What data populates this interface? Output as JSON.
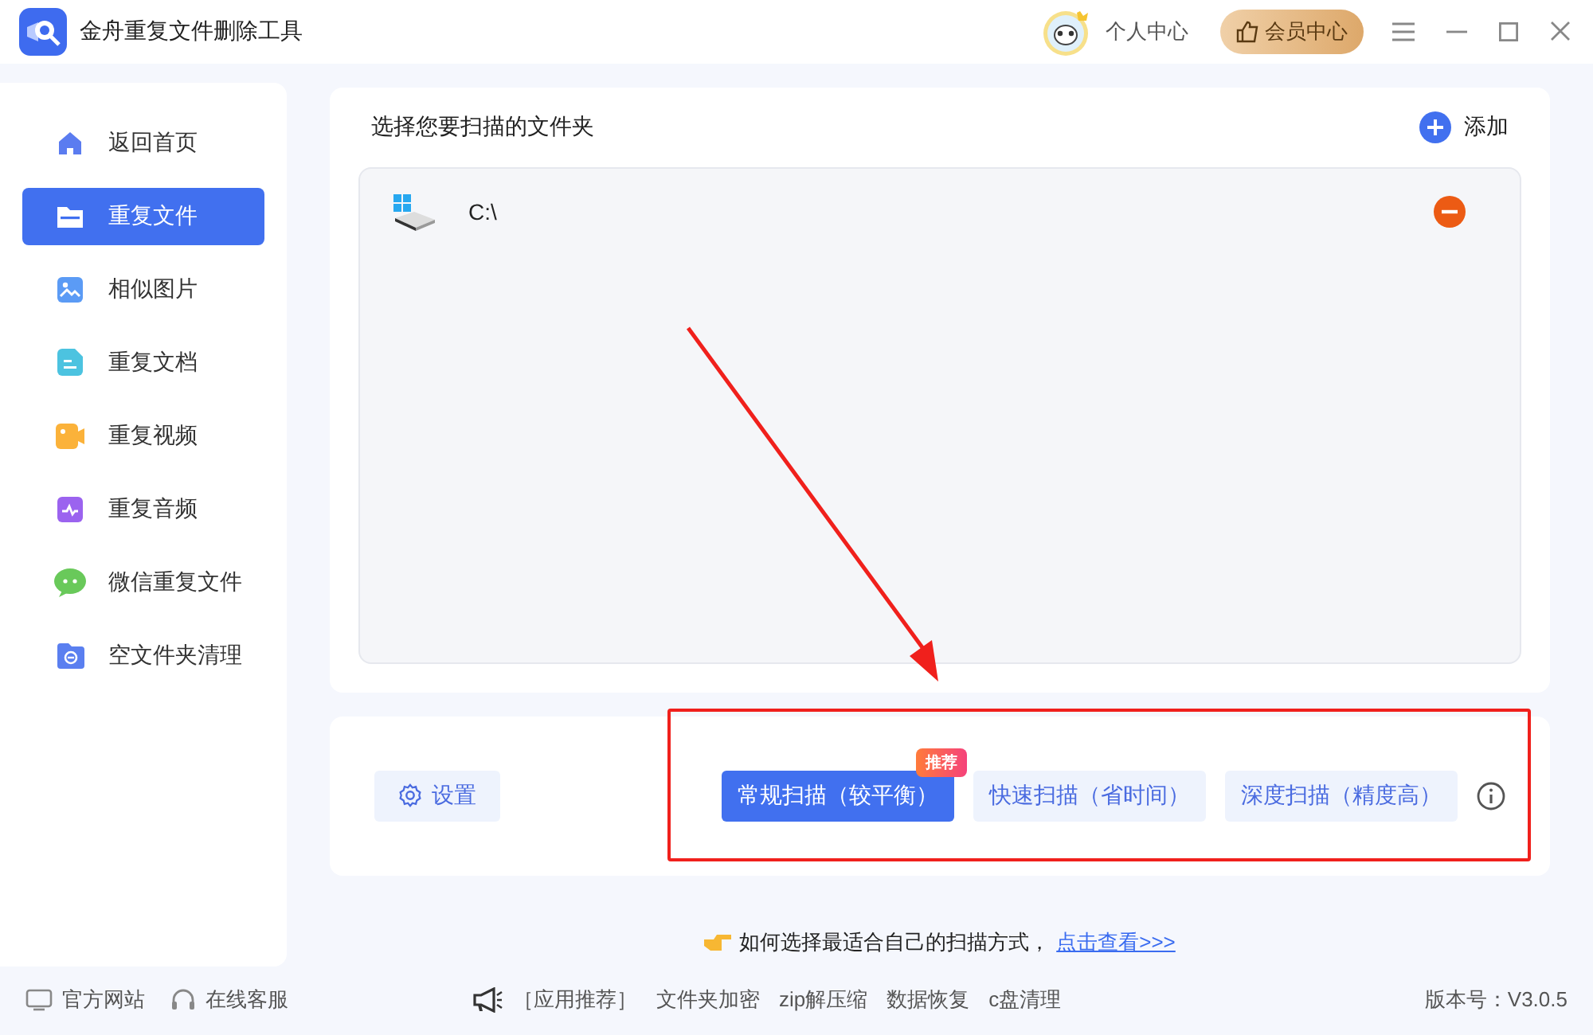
{
  "window": {
    "title": "金舟重复文件删除工具",
    "user_label": "个人中心",
    "vip_button": "会员中心"
  },
  "sidebar": {
    "items": [
      {
        "label": "返回首页",
        "kind": "home",
        "selected": false
      },
      {
        "label": "重复文件",
        "kind": "folder",
        "selected": true
      },
      {
        "label": "相似图片",
        "kind": "image",
        "selected": false
      },
      {
        "label": "重复文档",
        "kind": "doc",
        "selected": false
      },
      {
        "label": "重复视频",
        "kind": "video",
        "selected": false
      },
      {
        "label": "重复音频",
        "kind": "audio",
        "selected": false
      },
      {
        "label": "微信重复文件",
        "kind": "chat",
        "selected": false
      },
      {
        "label": "空文件夹清理",
        "kind": "empty",
        "selected": false
      }
    ]
  },
  "folders": {
    "title": "选择您要扫描的文件夹",
    "add_button": "添加",
    "items": [
      {
        "path": "C:\\"
      }
    ]
  },
  "scan": {
    "settings_button": "设置",
    "modes": [
      {
        "label": "常规扫描（较平衡）",
        "selected": true,
        "badge": "推荐"
      },
      {
        "label": "快速扫描（省时间）",
        "selected": false
      },
      {
        "label": "深度扫描（精度高）",
        "selected": false
      }
    ]
  },
  "hint": {
    "text": "如何选择最适合自己的扫描方式，",
    "link": "点击查看>>>"
  },
  "footer": {
    "left_links": [
      {
        "label": "官方网站",
        "kind": "monitor"
      },
      {
        "label": "在线客服",
        "kind": "headset"
      }
    ],
    "promo_label": "［应用推荐］",
    "promo_links": [
      "文件夹加密",
      "zip解压缩",
      "数据恢复",
      "c盘清理"
    ],
    "version": "版本号：V3.0.5"
  }
}
